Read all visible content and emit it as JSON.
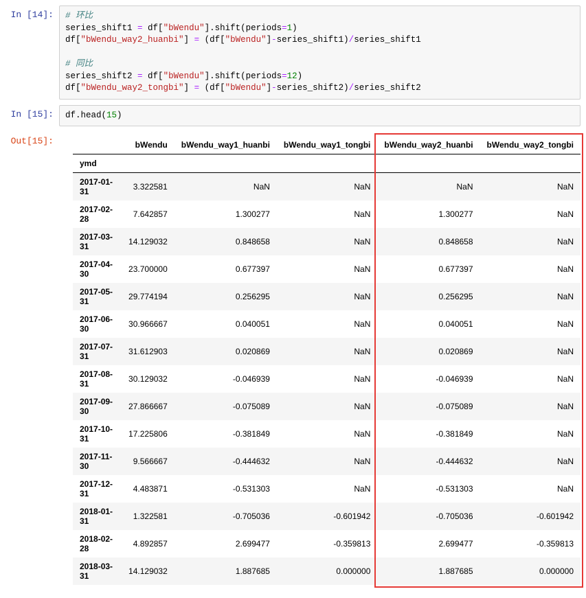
{
  "cells": {
    "c14": {
      "prompt": "In [14]:",
      "code": {
        "l1_comment": "# 环比",
        "l2_a": "series_shift1 ",
        "l2_op": "=",
        "l2_b": " df[",
        "l2_str": "\"bWendu\"",
        "l2_c": "].shift(periods",
        "l2_op2": "=",
        "l2_num": "1",
        "l2_d": ")",
        "l3_a": "df[",
        "l3_str": "\"bWendu_way2_huanbi\"",
        "l3_b": "] ",
        "l3_op": "=",
        "l3_c": " (df[",
        "l3_str2": "\"bWendu\"",
        "l3_d": "]",
        "l3_op2": "-",
        "l3_e": "series_shift1)",
        "l3_op3": "/",
        "l3_f": "series_shift1",
        "l5_comment": "# 同比",
        "l6_a": "series_shift2 ",
        "l6_op": "=",
        "l6_b": " df[",
        "l6_str": "\"bWendu\"",
        "l6_c": "].shift(periods",
        "l6_op2": "=",
        "l6_num": "12",
        "l6_d": ")",
        "l7_a": "df[",
        "l7_str": "\"bWendu_way2_tongbi\"",
        "l7_b": "] ",
        "l7_op": "=",
        "l7_c": " (df[",
        "l7_str2": "\"bWendu\"",
        "l7_d": "]",
        "l7_op2": "-",
        "l7_e": "series_shift2)",
        "l7_op3": "/",
        "l7_f": "series_shift2"
      }
    },
    "c15": {
      "prompt": "In [15]:",
      "code": {
        "l1_a": "df.head(",
        "l1_num": "15",
        "l1_b": ")"
      },
      "out_prompt": "Out[15]:"
    }
  },
  "table": {
    "index_name": "ymd",
    "columns": [
      "bWendu",
      "bWendu_way1_huanbi",
      "bWendu_way1_tongbi",
      "bWendu_way2_huanbi",
      "bWendu_way2_tongbi"
    ],
    "rows": [
      {
        "idx": "2017-01-31",
        "v": [
          "3.322581",
          "NaN",
          "NaN",
          "NaN",
          "NaN"
        ]
      },
      {
        "idx": "2017-02-28",
        "v": [
          "7.642857",
          "1.300277",
          "NaN",
          "1.300277",
          "NaN"
        ]
      },
      {
        "idx": "2017-03-31",
        "v": [
          "14.129032",
          "0.848658",
          "NaN",
          "0.848658",
          "NaN"
        ]
      },
      {
        "idx": "2017-04-30",
        "v": [
          "23.700000",
          "0.677397",
          "NaN",
          "0.677397",
          "NaN"
        ]
      },
      {
        "idx": "2017-05-31",
        "v": [
          "29.774194",
          "0.256295",
          "NaN",
          "0.256295",
          "NaN"
        ]
      },
      {
        "idx": "2017-06-30",
        "v": [
          "30.966667",
          "0.040051",
          "NaN",
          "0.040051",
          "NaN"
        ]
      },
      {
        "idx": "2017-07-31",
        "v": [
          "31.612903",
          "0.020869",
          "NaN",
          "0.020869",
          "NaN"
        ]
      },
      {
        "idx": "2017-08-31",
        "v": [
          "30.129032",
          "-0.046939",
          "NaN",
          "-0.046939",
          "NaN"
        ]
      },
      {
        "idx": "2017-09-30",
        "v": [
          "27.866667",
          "-0.075089",
          "NaN",
          "-0.075089",
          "NaN"
        ]
      },
      {
        "idx": "2017-10-31",
        "v": [
          "17.225806",
          "-0.381849",
          "NaN",
          "-0.381849",
          "NaN"
        ]
      },
      {
        "idx": "2017-11-30",
        "v": [
          "9.566667",
          "-0.444632",
          "NaN",
          "-0.444632",
          "NaN"
        ]
      },
      {
        "idx": "2017-12-31",
        "v": [
          "4.483871",
          "-0.531303",
          "NaN",
          "-0.531303",
          "NaN"
        ]
      },
      {
        "idx": "2018-01-31",
        "v": [
          "1.322581",
          "-0.705036",
          "-0.601942",
          "-0.705036",
          "-0.601942"
        ]
      },
      {
        "idx": "2018-02-28",
        "v": [
          "4.892857",
          "2.699477",
          "-0.359813",
          "2.699477",
          "-0.359813"
        ]
      },
      {
        "idx": "2018-03-31",
        "v": [
          "14.129032",
          "1.887685",
          "0.000000",
          "1.887685",
          "0.000000"
        ]
      }
    ]
  }
}
